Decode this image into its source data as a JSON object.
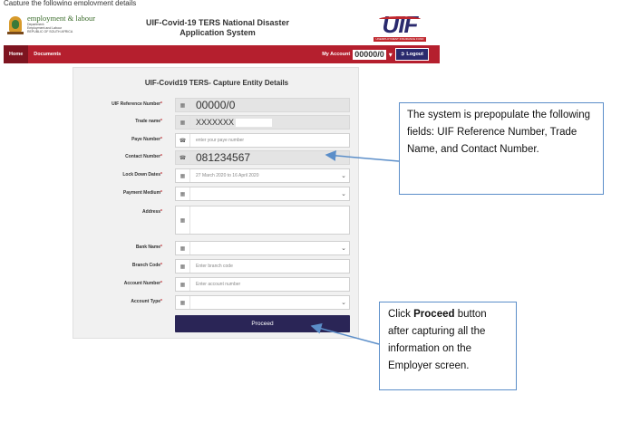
{
  "header": {
    "top_caption": "Capture the following employment details",
    "dept_name": "employment & labour",
    "dept_sub_1": "Department:",
    "dept_sub_2": "Employment and Labour",
    "dept_sub_3": "REPUBLIC OF SOUTH AFRICA",
    "system_title_line1": "UIF-Covid-19 TERS National Disaster",
    "system_title_line2": "Application System",
    "uif_logo_text": "UIF",
    "uif_logo_band": "UNEMPLOYMENT INSURANCE FUND"
  },
  "nav": {
    "items": [
      {
        "label": "Home"
      },
      {
        "label": "Documents"
      }
    ],
    "account_label": "My Account",
    "account_id": "00000/0",
    "logout_label": "Logout"
  },
  "form": {
    "title": "UIF-Covid19 TERS- Capture Entity Details",
    "fields": [
      {
        "label": "UIF Reference Number",
        "value": "00000/0",
        "placeholder": ""
      },
      {
        "label": "Trade name",
        "value": "XXXXXXX",
        "placeholder": ""
      },
      {
        "label": "Paye Number",
        "value": "",
        "placeholder": "enter your paye number"
      },
      {
        "label": "Contact Number",
        "value": "081234567",
        "placeholder": ""
      },
      {
        "label": "Lock Down Dates",
        "value": "27 March 2020 to 16 April 2020",
        "placeholder": ""
      },
      {
        "label": "Payment Medium",
        "value": "",
        "placeholder": ""
      },
      {
        "label": "Address",
        "value": "",
        "placeholder": ""
      },
      {
        "label": "Bank Name",
        "value": "",
        "placeholder": ""
      },
      {
        "label": "Branch Code",
        "value": "",
        "placeholder": "Enter branch code"
      },
      {
        "label": "Account Number",
        "value": "",
        "placeholder": "Enter account number"
      },
      {
        "label": "Account Type",
        "value": "",
        "placeholder": ""
      }
    ],
    "required_mark": "*",
    "proceed_label": "Proceed"
  },
  "callouts": {
    "prepopulate": "The system is prepopulate the following fields: UIF Reference Number, Trade Name, and Contact Number.",
    "proceed_pre": "Click ",
    "proceed_bold": "Proceed",
    "proceed_post": " button after capturing all the information on the Employer screen."
  },
  "icons": {
    "building": "building-icon",
    "phone": "phone-icon",
    "chevron": "chevron-down-icon",
    "logout": "logout-icon"
  },
  "colors": {
    "nav_red": "#b51f2e",
    "proceed_navy": "#2a2556",
    "callout_blue": "#5b8ec9"
  }
}
